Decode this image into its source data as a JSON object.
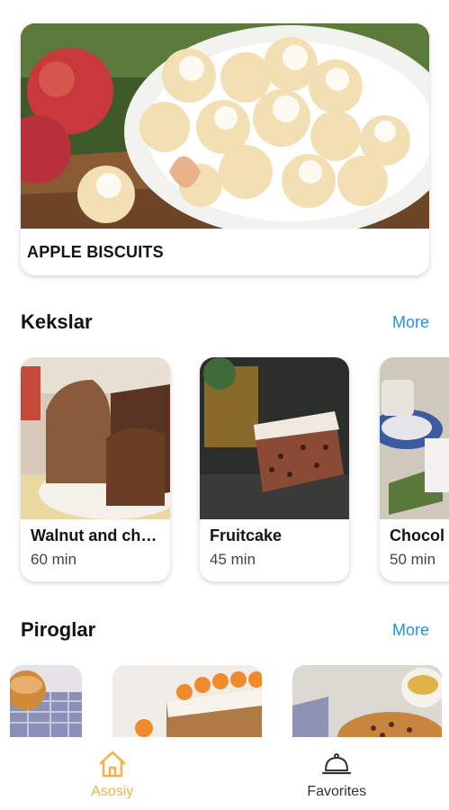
{
  "featured": {
    "title": "APPLE BISCUITS"
  },
  "sections": [
    {
      "title": "Kekslar",
      "more_label": "More",
      "cards": [
        {
          "title": "Walnut and ch…",
          "time": "60 min"
        },
        {
          "title": "Fruitcake",
          "time": "45 min"
        },
        {
          "title": "Chocol",
          "time": "50 min"
        }
      ]
    },
    {
      "title": "Piroglar",
      "more_label": "More"
    }
  ],
  "bottom_nav": {
    "items": [
      {
        "label": "Asosiy",
        "icon": "home-icon",
        "active": true
      },
      {
        "label": "Favorites",
        "icon": "cloche-icon",
        "active": false
      }
    ]
  },
  "colors": {
    "accent_more": "#2f8fd9",
    "nav_active": "#f4b24a",
    "nav_inactive": "#333333"
  }
}
